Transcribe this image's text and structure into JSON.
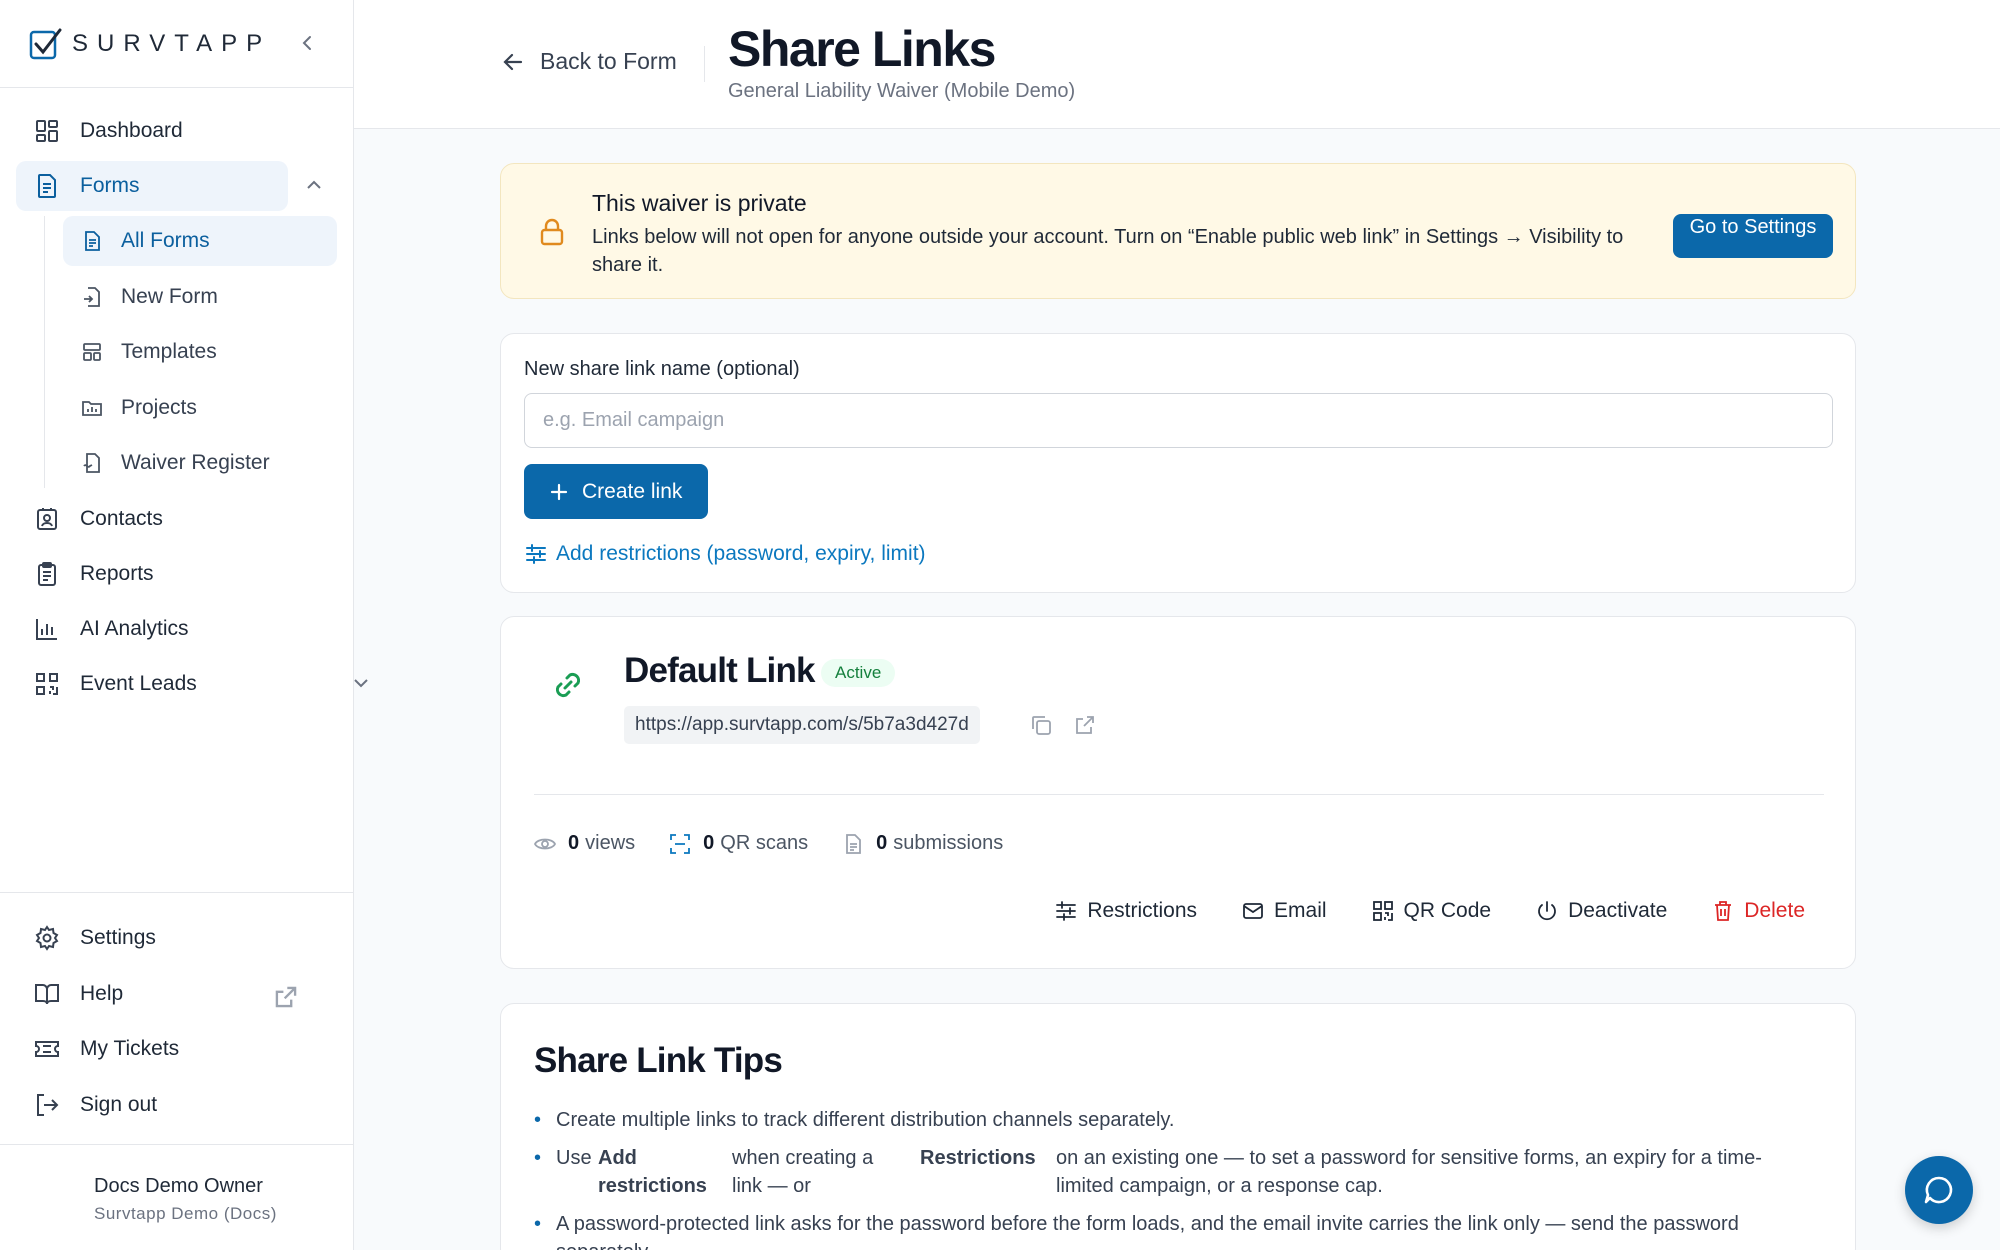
{
  "brand": {
    "name": "SURVTAPP"
  },
  "sidebar": {
    "items": [
      {
        "label": "Dashboard"
      },
      {
        "label": "Forms"
      },
      {
        "label": "Contacts"
      },
      {
        "label": "Reports"
      },
      {
        "label": "AI Analytics"
      },
      {
        "label": "Event Leads"
      }
    ],
    "forms_sub": [
      {
        "label": "All Forms"
      },
      {
        "label": "New Form"
      },
      {
        "label": "Templates"
      },
      {
        "label": "Projects"
      },
      {
        "label": "Waiver Register"
      }
    ],
    "bottom": [
      {
        "label": "Settings"
      },
      {
        "label": "Help"
      },
      {
        "label": "My Tickets"
      },
      {
        "label": "Sign out"
      }
    ],
    "user": {
      "name": "Docs Demo Owner",
      "org": "Survtapp Demo (Docs)"
    }
  },
  "header": {
    "back_label": "Back to Form",
    "title": "Share Links",
    "subtitle": "General Liability Waiver (Mobile Demo)"
  },
  "notice": {
    "title": "This waiver is private",
    "text": "Links below will not open for anyone outside your account. Turn on “Enable public web link” in Settings → Visibility to share it.",
    "button": "Go to Settings"
  },
  "create": {
    "label": "New share link name (optional)",
    "placeholder": "e.g. Email campaign",
    "value": "",
    "button": "Create link",
    "restrictions_link": "Add restrictions (password, expiry, limit)"
  },
  "link": {
    "name": "Default Link",
    "status": "Active",
    "url": "https://app.survtapp.com/s/5b7a3d427d",
    "stats": [
      {
        "count": "0",
        "label": "views"
      },
      {
        "count": "0",
        "label": "QR scans"
      },
      {
        "count": "0",
        "label": "submissions"
      }
    ],
    "actions": [
      "Restrictions",
      "Email",
      "QR Code",
      "Deactivate",
      "Delete"
    ]
  },
  "tips": {
    "title": "Share Link Tips",
    "tip1": "Create multiple links to track different distribution channels separately.",
    "tip2": {
      "a": "Use",
      "b": "Add restrictions",
      "c": "when creating a link — or",
      "d": "Restrictions",
      "e": "on an existing one — to set a password for sensitive forms, an expiry for a time-limited campaign, or a response cap."
    },
    "tip3": "A password-protected link asks for the password before the form loads, and the email invite carries the link only — send the password separately."
  },
  "colors": {
    "accent": "#0b68aa",
    "active": "#15803d",
    "danger": "#dc2626",
    "notice_bg": "#fff9e6"
  }
}
